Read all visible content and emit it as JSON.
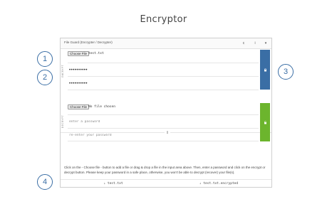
{
  "page": {
    "title": "Encryptor"
  },
  "callouts": [
    "1",
    "2",
    "3",
    "4"
  ],
  "panel": {
    "title": "File Guard (Encrypter / Decrypter)",
    "header_buttons": [
      "c",
      "i",
      "▾"
    ]
  },
  "encrypt": {
    "label": "ENCRYPT",
    "choose_label": "Choose File",
    "file_name": "test.txt",
    "password_mask": "••••••••••",
    "confirm_mask": "••••••••••",
    "accent": "#3a6ea5"
  },
  "swap_symbol": "⇕",
  "decrypt": {
    "label": "DECRYPT",
    "choose_label": "Choose File",
    "file_name": "No file chosen",
    "password_placeholder": "enter a password",
    "confirm_placeholder": "re-enter your password",
    "accent": "#6cb52d"
  },
  "help_text": "Click on the - Choose file - button to add a file or drag & drop a file in the input area above. Then, enter a password and click on the encrypt or decrypt button. Please keep your password in a safe place, otherwise, you won't be able to decrypt (recover) your file(s).",
  "downloads": {
    "plain": "⇣ test.txt",
    "encrypted": "⇣ test.txt.encrypted"
  }
}
